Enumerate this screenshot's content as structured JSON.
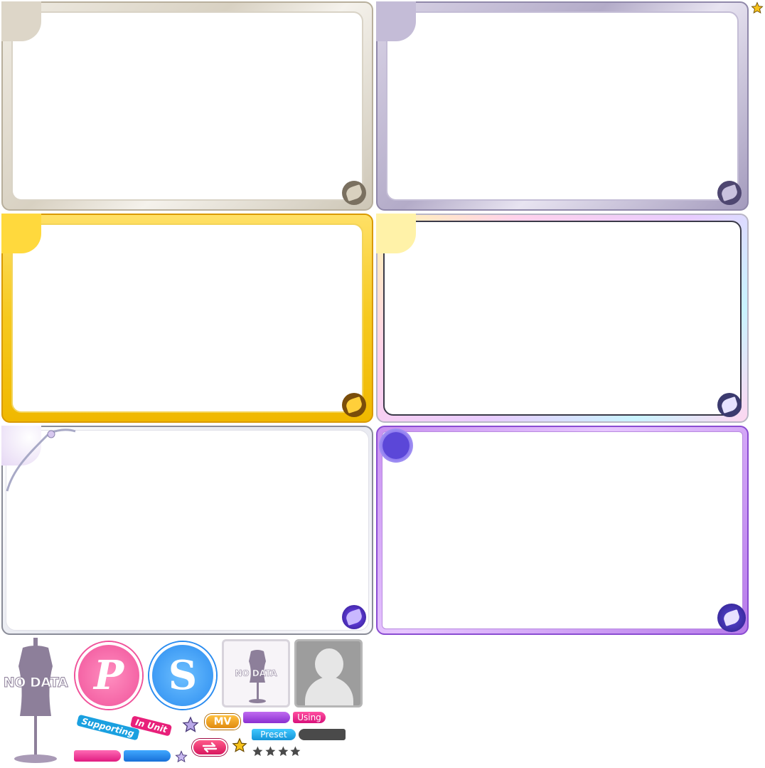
{
  "frames": [
    {
      "name": "frame-silver-beige",
      "border": "#e8e2d6",
      "accent": "#cfc7b6",
      "emblem": "#6b6152"
    },
    {
      "name": "frame-lavender",
      "border": "#c9c2d8",
      "accent": "#a79ec0",
      "emblem": "#4a416a"
    },
    {
      "name": "frame-gold",
      "border": "#f2c424",
      "accent": "#e0a10c",
      "emblem": "#7a4d0a"
    },
    {
      "name": "frame-rainbow",
      "border": "#f6e9ff",
      "accent": "#ffc8e8",
      "emblem": "#3b3a6e"
    },
    {
      "name": "frame-ornate-silver",
      "border": "#f2f2f4",
      "accent": "#d6d9e6",
      "emblem": "#5a2fb0"
    },
    {
      "name": "frame-purple-geometric",
      "border": "#c07fea",
      "accent": "#9a5be0",
      "emblem": "#4f3ad2"
    }
  ],
  "labels": {
    "no_data_large": "NO DATA",
    "no_data_small": "NO DATA",
    "p_badge": "P",
    "s_badge": "S",
    "supporting": "Supporting",
    "in_unit": "In Unit",
    "mv": "MV",
    "using": "Using",
    "preset": "Preset"
  },
  "colors": {
    "pink": "#f0529a",
    "blue": "#2a8cf0",
    "purple": "#9b3de0",
    "orange": "#f0a020",
    "magenta": "#e8207a",
    "cyan": "#18a8e8",
    "dark": "#4a4a4a",
    "mannequin": "#8d7f9a"
  },
  "stars": {
    "count": 4
  },
  "icons": [
    "gold-star-icon",
    "mannequin-icon",
    "p-badge-icon",
    "s-badge-icon",
    "avatar-silhouette-icon",
    "swap-icon",
    "lavender-star-icon"
  ]
}
